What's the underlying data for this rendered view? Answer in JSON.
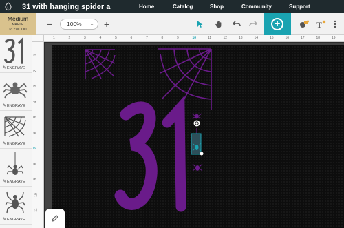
{
  "header": {
    "project_title": "31 with hanging spider a",
    "nav": [
      {
        "label": "Home"
      },
      {
        "label": "Catalog"
      },
      {
        "label": "Shop"
      },
      {
        "label": "Community"
      },
      {
        "label": "Support"
      }
    ]
  },
  "material": {
    "size": "Medium",
    "name_line1": "Maple",
    "name_line2": "Plywood"
  },
  "toolbar": {
    "zoom_value": "100%"
  },
  "library": {
    "items": [
      {
        "name": "31",
        "mode_label": "ENGRAVE"
      },
      {
        "name": "spider",
        "mode_label": "ENGRAVE"
      },
      {
        "name": "spider web",
        "mode_label": "ENGRAVE"
      },
      {
        "name": "hanging spider",
        "mode_label": "ENGRAVE"
      },
      {
        "name": "spider",
        "mode_label": "ENGRAVE"
      }
    ]
  },
  "rulers": {
    "top": [
      "1",
      "2",
      "3",
      "4",
      "5",
      "6",
      "7",
      "8",
      "9",
      "10",
      "11",
      "12",
      "13",
      "14",
      "15",
      "16",
      "17",
      "18",
      "19"
    ],
    "left": [
      "1",
      "2",
      "3",
      "4",
      "5",
      "6",
      "7",
      "8",
      "9",
      "10",
      "11"
    ]
  },
  "colors": {
    "accent": "#1aa3b1",
    "design_purple": "#6a1b8a",
    "material_tan": "#d9c28d",
    "nav_bg": "#1f2a2e"
  }
}
